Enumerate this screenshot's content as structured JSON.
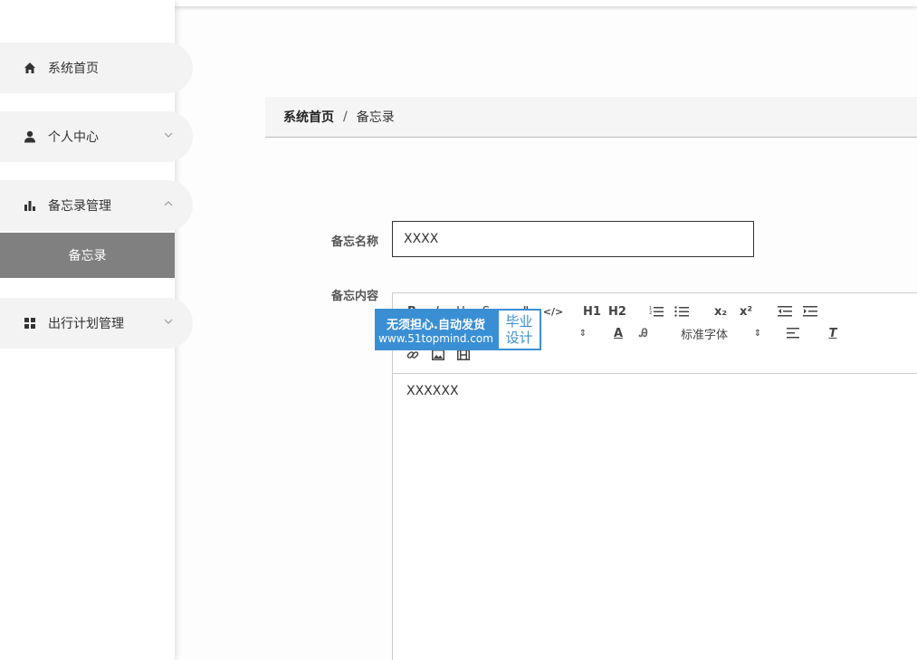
{
  "sidebar": {
    "items": [
      {
        "label": "系统首页",
        "icon": "home-icon"
      },
      {
        "label": "个人中心",
        "icon": "user-icon",
        "expanded": false
      },
      {
        "label": "备忘录管理",
        "icon": "bar-chart-icon",
        "expanded": true
      },
      {
        "label": "出行计划管理",
        "icon": "grid-icon",
        "expanded": false
      }
    ],
    "submenu": {
      "label": "备忘录"
    }
  },
  "breadcrumb": {
    "home": "系统首页",
    "separator": "/",
    "current": "备忘录"
  },
  "form": {
    "name_label": "备忘名称",
    "name_value": "XXXX",
    "content_label": "备忘内容",
    "content_value": "XXXXXX"
  },
  "editor": {
    "toolbar": {
      "h1": "H1",
      "h2": "H2",
      "subscript": "x₂",
      "superscript": "x²",
      "font_family": "标准字体"
    }
  },
  "watermark": {
    "line1": "无须担心.自动发货",
    "line2": "www.51topmind.com",
    "right_top": "毕业",
    "right_bottom": "设计"
  },
  "colors": {
    "menu_bg": "#f4f3f3",
    "submenu_active": "#808080",
    "watermark_blue": "#3a8fd4"
  }
}
